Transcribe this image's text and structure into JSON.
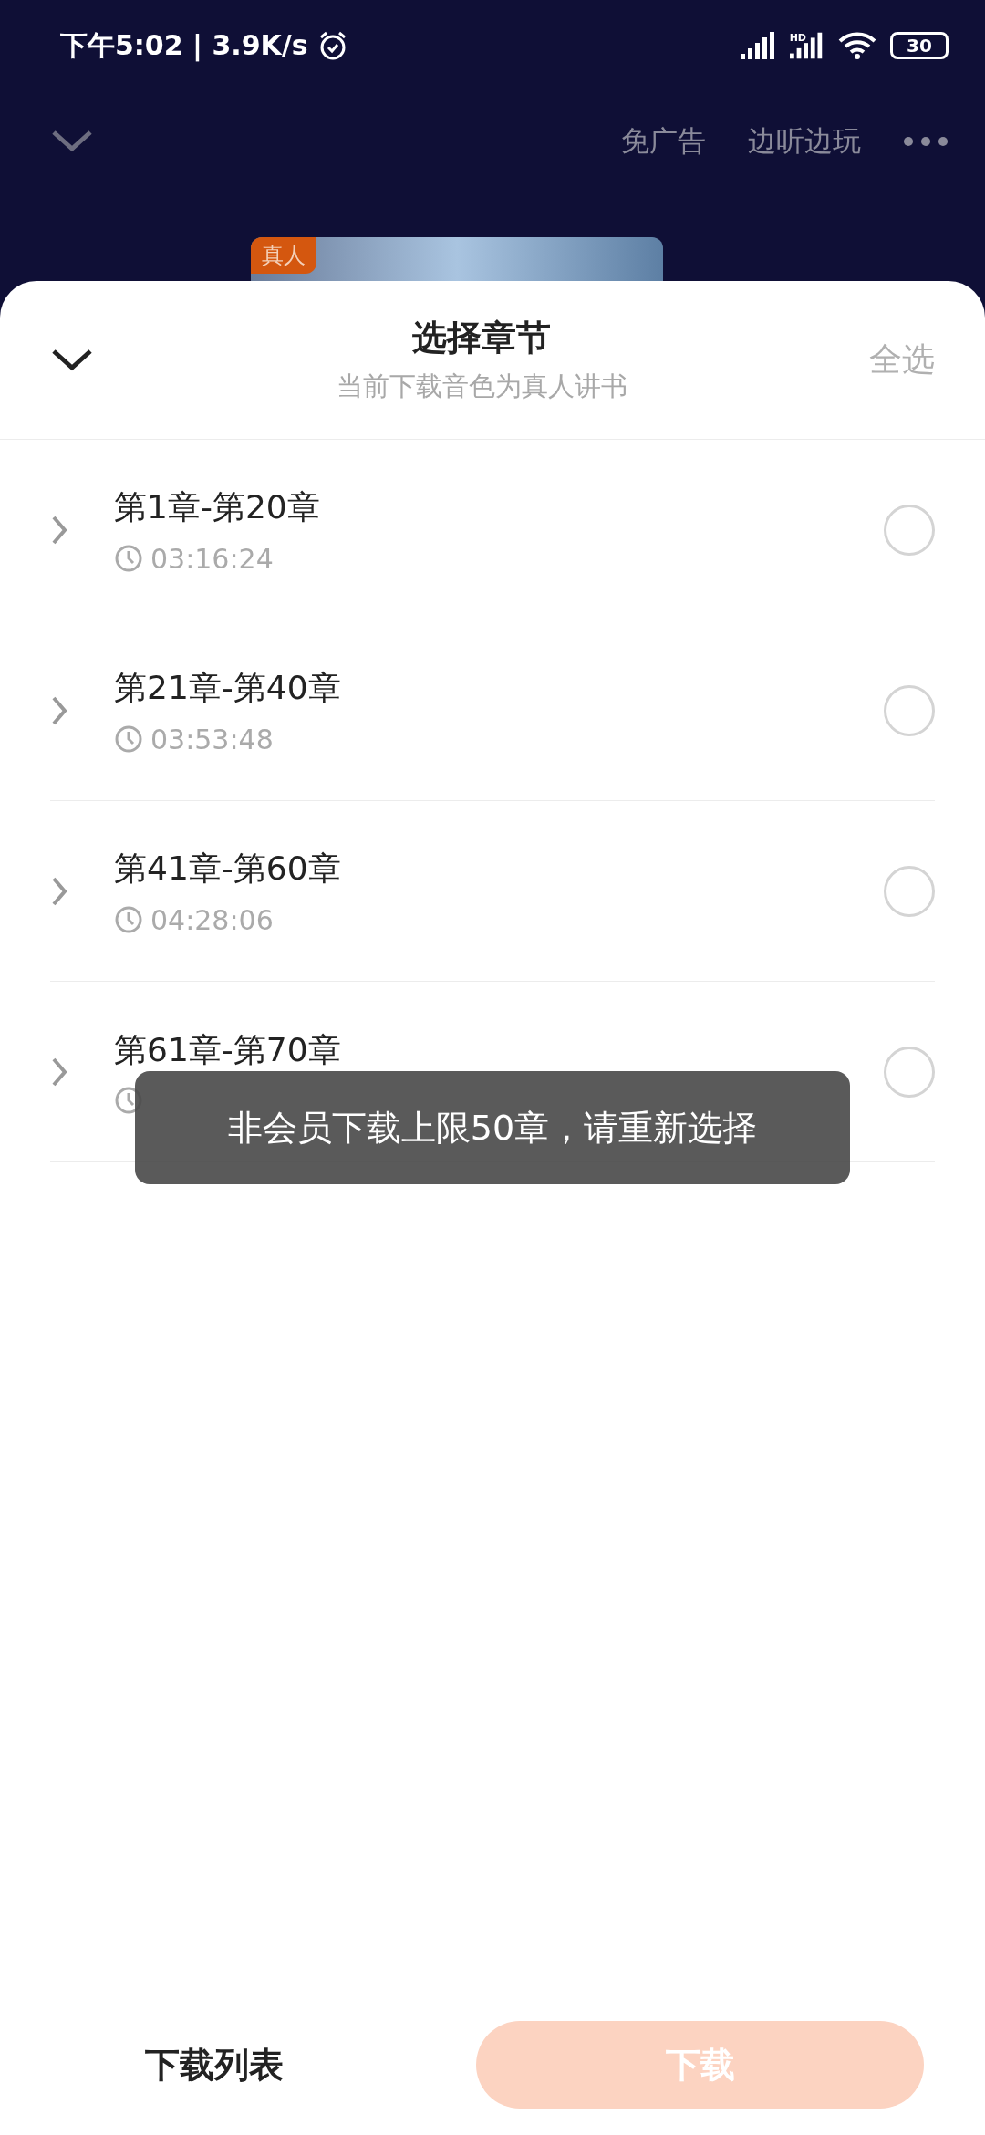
{
  "status_bar": {
    "time": "下午5:02 | 3.9K/s",
    "battery": "30",
    "network_label": "HD"
  },
  "top_bar": {
    "actions": [
      "免广告",
      "边听边玩"
    ]
  },
  "cover": {
    "badge": "真人"
  },
  "sheet": {
    "title": "选择章节",
    "subtitle": "当前下载音色为真人讲书",
    "select_all": "全选",
    "chapters": [
      {
        "title": "第1章-第20章",
        "duration": "03:16:24",
        "selected": false
      },
      {
        "title": "第21章-第40章",
        "duration": "03:53:48",
        "selected": false
      },
      {
        "title": "第41章-第60章",
        "duration": "04:28:06",
        "selected": false
      },
      {
        "title": "第61章-第70章",
        "selected": false
      }
    ]
  },
  "toast": "非会员下载上限50章，请重新选择",
  "footer": {
    "list_button": "下载列表",
    "download_button": "下载",
    "download_disabled": true
  }
}
